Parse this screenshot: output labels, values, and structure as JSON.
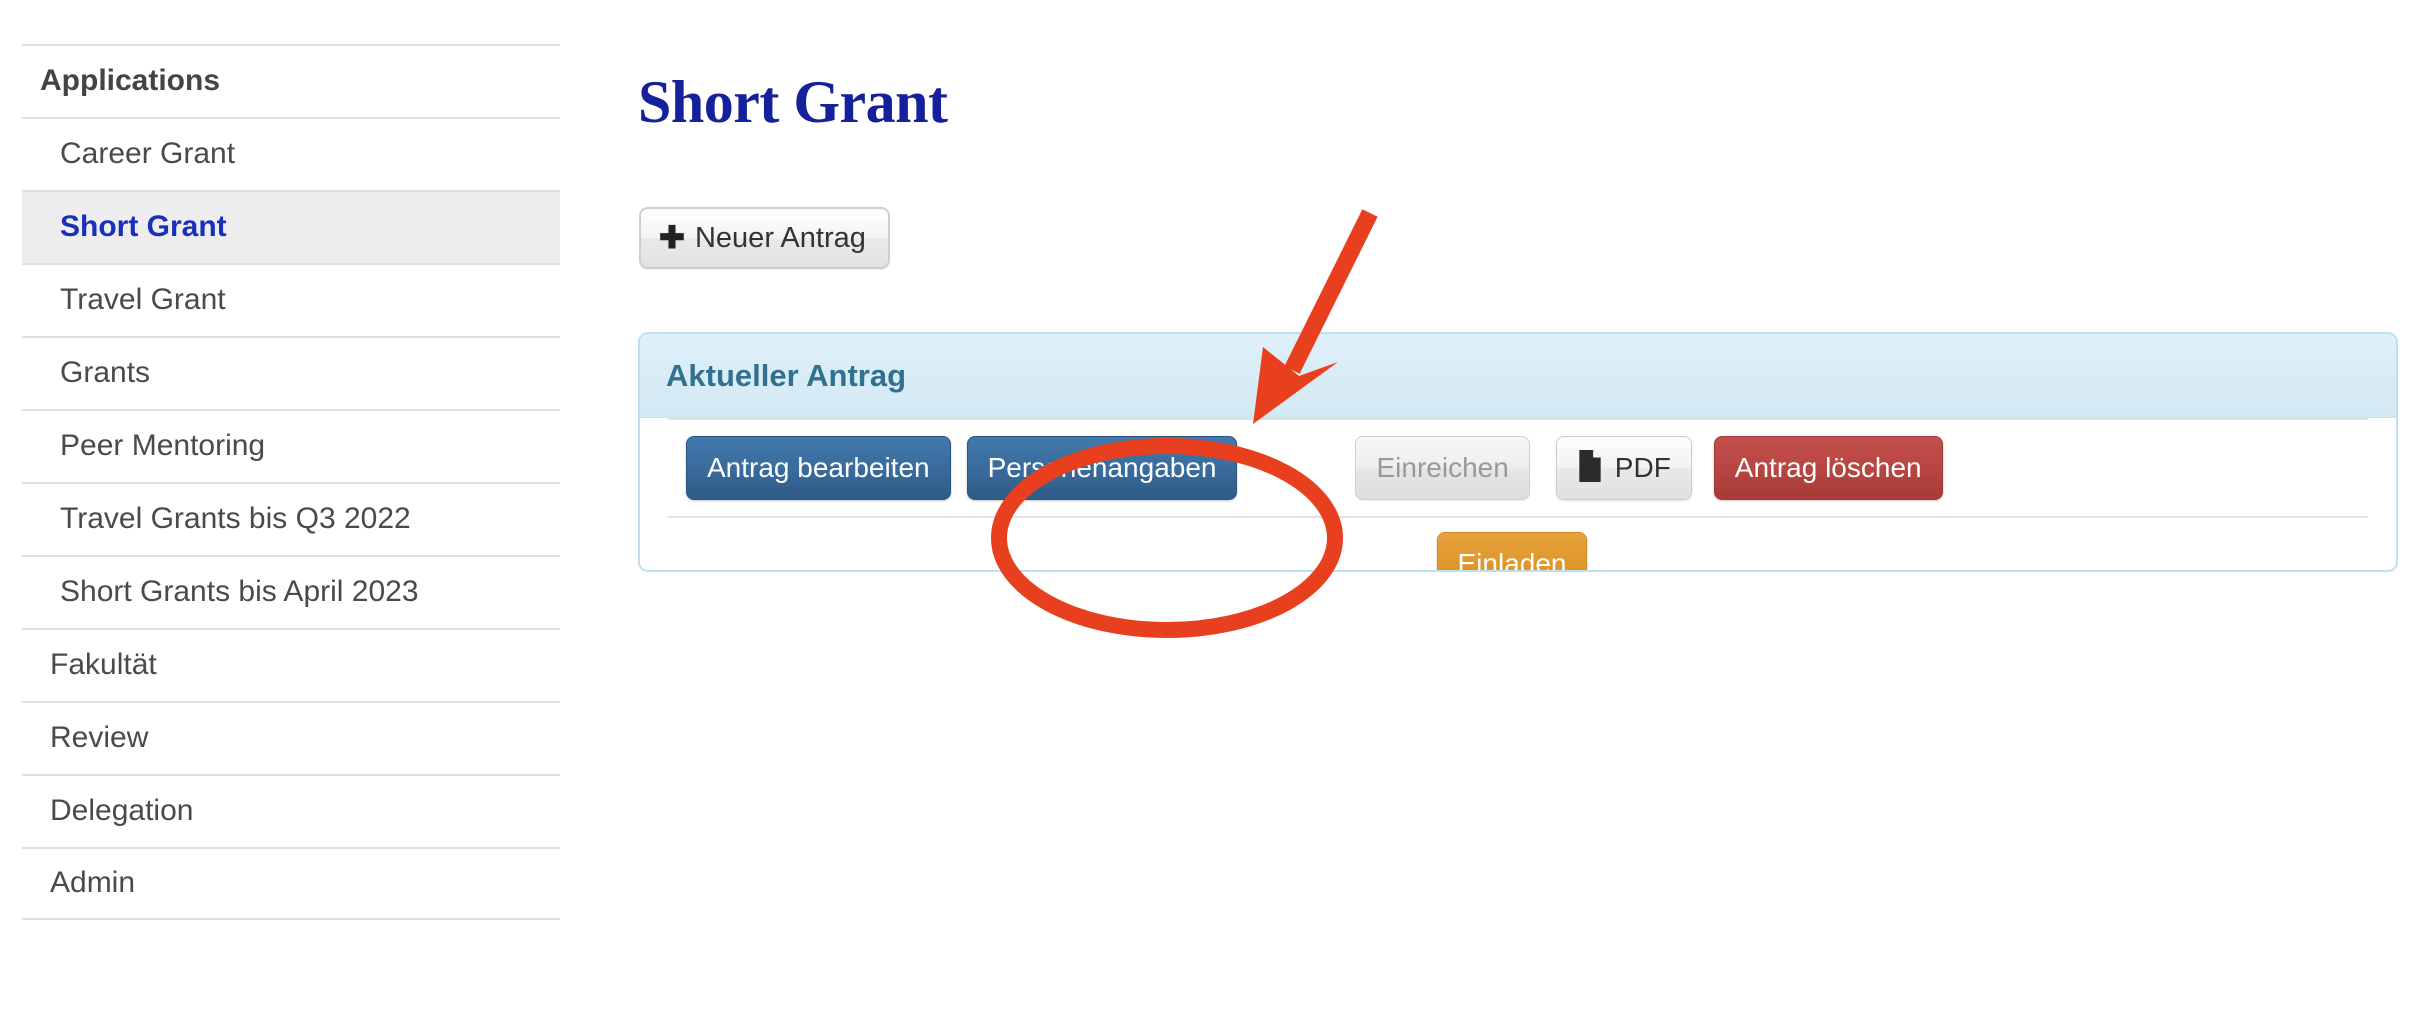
{
  "sidebar": {
    "items": [
      {
        "label": "Applications",
        "kind": "header",
        "active": false
      },
      {
        "label": "Career Grant",
        "kind": "sub",
        "active": false
      },
      {
        "label": "Short Grant",
        "kind": "sub",
        "active": true
      },
      {
        "label": "Travel Grant",
        "kind": "sub",
        "active": false
      },
      {
        "label": "Grants",
        "kind": "sub",
        "active": false
      },
      {
        "label": "Peer Mentoring",
        "kind": "sub",
        "active": false
      },
      {
        "label": "Travel Grants bis Q3 2022",
        "kind": "sub",
        "active": false
      },
      {
        "label": "Short Grants bis April 2023",
        "kind": "sub",
        "active": false
      },
      {
        "label": "Fakultät",
        "kind": "top",
        "active": false
      },
      {
        "label": "Review",
        "kind": "top",
        "active": false
      },
      {
        "label": "Delegation",
        "kind": "top",
        "active": false
      },
      {
        "label": "Admin",
        "kind": "top",
        "active": false
      }
    ]
  },
  "main": {
    "page_title": "Short Grant",
    "new_application_button": {
      "label": "Neuer Antrag",
      "icon": "plus-icon",
      "icon_glyph": "✚"
    },
    "panel": {
      "header_title": "Aktueller Antrag",
      "actions_row": [
        {
          "label": "Antrag bearbeiten",
          "style": "primary",
          "name": "edit-application-button",
          "disabled": false
        },
        {
          "label": "Personenangaben",
          "style": "primary",
          "name": "personal-details-button",
          "disabled": false
        },
        {
          "label": "Einreichen",
          "style": "default",
          "name": "submit-button",
          "disabled": true
        },
        {
          "label": "PDF",
          "style": "pdf",
          "name": "pdf-button",
          "icon": "file-icon",
          "disabled": false
        },
        {
          "label": "Antrag löschen",
          "style": "danger",
          "name": "delete-application-button",
          "disabled": false
        }
      ],
      "invite_row": [
        {
          "label": "Einladen",
          "style": "warning",
          "name": "invite-button",
          "disabled": false
        }
      ]
    }
  },
  "annotation": {
    "highlight_target": "Personenangaben",
    "shapes": [
      "arrow",
      "ellipse"
    ],
    "color": "#e8401f"
  },
  "colors": {
    "accent_blue": "#3a6d9e",
    "title_blue": "#15209b",
    "panel_header_bg": "#d9edf7",
    "panel_header_text": "#31708f",
    "panel_border": "#bfe0f0",
    "danger_red": "#b94642",
    "warning_orange": "#e0982f",
    "annotation_red": "#e8401f",
    "sidebar_active_bg": "#ededf0",
    "sidebar_active_text": "#1a2fb8"
  }
}
